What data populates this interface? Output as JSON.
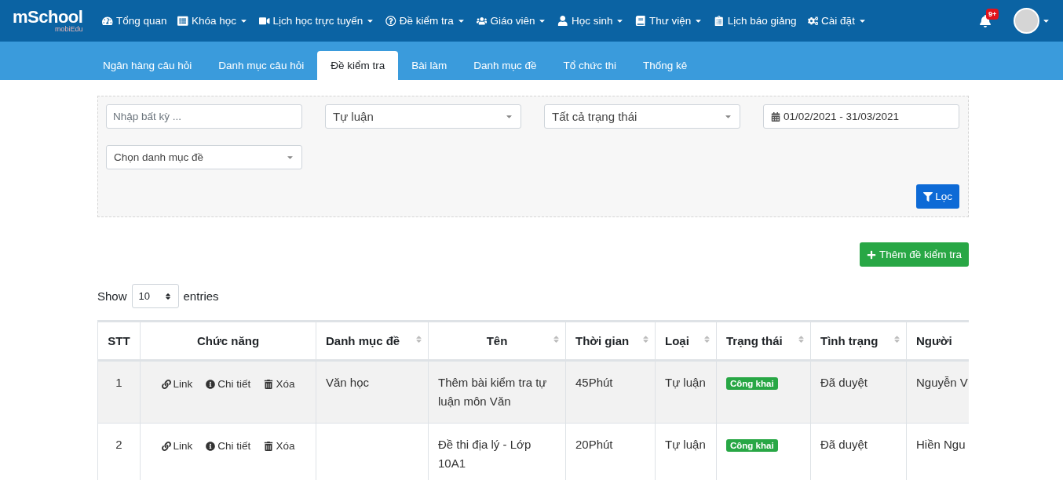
{
  "logo": {
    "name": "mSchool",
    "sub": "mobiEdu"
  },
  "nav": [
    {
      "label": "Tổng quan",
      "dropdown": false
    },
    {
      "label": "Khóa học",
      "dropdown": true
    },
    {
      "label": "Lịch học trực tuyến",
      "dropdown": true
    },
    {
      "label": "Đề kiểm tra",
      "dropdown": true
    },
    {
      "label": "Giáo viên",
      "dropdown": true
    },
    {
      "label": "Học sinh",
      "dropdown": true
    },
    {
      "label": "Thư viện",
      "dropdown": true
    },
    {
      "label": "Lịch báo giảng",
      "dropdown": false
    },
    {
      "label": "Cài đặt",
      "dropdown": true
    }
  ],
  "notifications": {
    "badge": "9+"
  },
  "tabs": [
    {
      "label": "Ngân hàng câu hỏi",
      "selected": false
    },
    {
      "label": "Danh mục câu hỏi",
      "selected": false
    },
    {
      "label": "Đề kiểm tra",
      "selected": true
    },
    {
      "label": "Bài làm",
      "selected": false
    },
    {
      "label": "Danh mục đề",
      "selected": false
    },
    {
      "label": "Tổ chức thi",
      "selected": false
    },
    {
      "label": "Thống kê",
      "selected": false
    }
  ],
  "filters": {
    "search": {
      "placeholder": "Nhập bất kỳ ..."
    },
    "type": "Tự luận",
    "status": "Tất cả trạng thái",
    "date_range": "01/02/2021 - 31/03/2021",
    "category": "Chọn danh mục đề",
    "filter_button": "Lọc"
  },
  "add_button": "Thêm đề kiểm tra",
  "length": {
    "show": "Show",
    "value": "10",
    "entries": "entries"
  },
  "table": {
    "columns": [
      {
        "label": "STT",
        "sortable": false
      },
      {
        "label": "Chức năng",
        "sortable": false
      },
      {
        "label": "Danh mục đề",
        "sortable": true
      },
      {
        "label": "Tên",
        "sortable": true
      },
      {
        "label": "Thời gian",
        "sortable": true
      },
      {
        "label": "Loại",
        "sortable": true
      },
      {
        "label": "Trạng thái",
        "sortable": true
      },
      {
        "label": "Tình trạng",
        "sortable": true
      },
      {
        "label": "Người",
        "sortable": false
      }
    ],
    "rows": [
      {
        "stt": "1",
        "actions": [
          "Link",
          "Chi tiết",
          "Xóa"
        ],
        "category": "Văn học",
        "name": "Thêm bài kiểm tra tự luận môn Văn",
        "duration": "45Phút",
        "type": "Tự luận",
        "status": "Công khai",
        "state": "Đã duyệt",
        "person": "Nguyễn V"
      },
      {
        "stt": "2",
        "actions": [
          "Link",
          "Chi tiết",
          "Xóa"
        ],
        "category": "",
        "name": "Đề thi địa lý - Lớp 10A1",
        "duration": "20Phút",
        "type": "Tự luận",
        "status": "Công khai",
        "state": "Đã duyệt",
        "person": "Hiền Ngu"
      }
    ]
  }
}
